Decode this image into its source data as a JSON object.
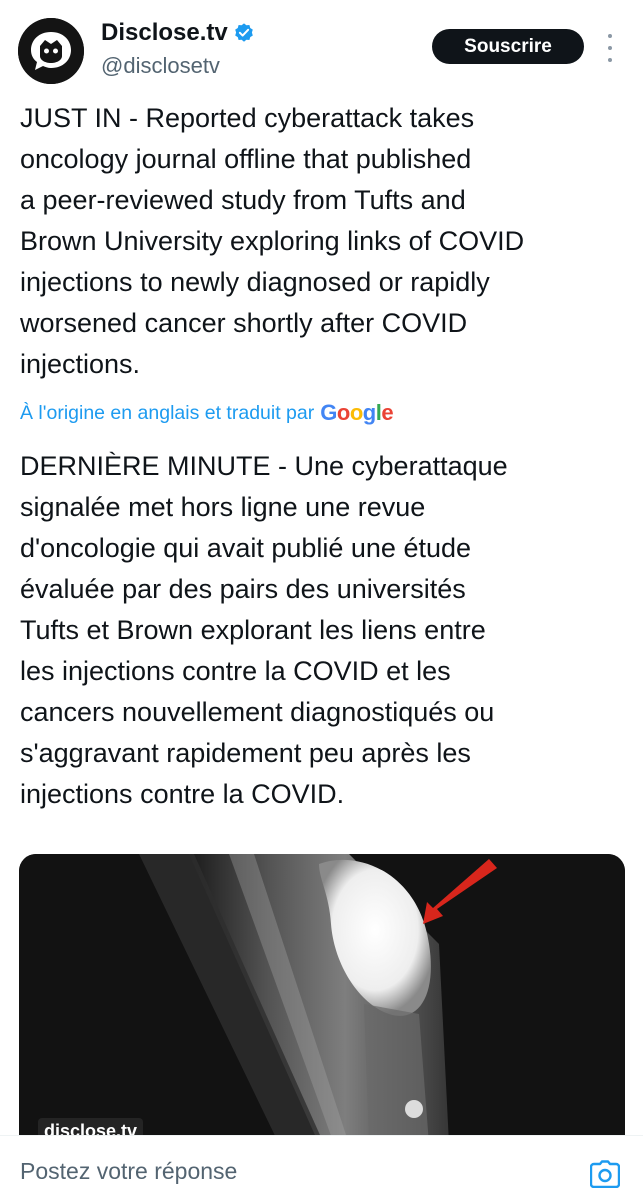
{
  "tweet": {
    "author_name": "Disclose.tv",
    "handle": "@disclosetv",
    "subscribe_label": "Souscrire",
    "original_lines": [
      "JUST IN - Reported cyberattack takes",
      "oncology journal offline that published",
      "a peer-reviewed study from Tufts and",
      "Brown University exploring links of COVID",
      "injections to newly diagnosed or rapidly",
      "worsened cancer shortly after COVID",
      "injections."
    ],
    "translation_label": "À l'origine en anglais et traduit par",
    "translation_provider": "Google",
    "translated_lines": [
      "DERNIÈRE MINUTE - Une cyberattaque",
      "signalée met hors ligne une revue",
      "d'oncologie qui avait publié une étude",
      "évaluée par des pairs des universités",
      "Tufts et Brown explorant les liens entre",
      "les injections contre la COVID et les",
      "cancers nouvellement diagnostiqués ou",
      "s'aggravant rapidement peu après les",
      "injections contre la COVID."
    ],
    "media_watermark": "disclose.tv"
  },
  "reply": {
    "placeholder": "Postez votre réponse"
  },
  "icons": {
    "verified": "verified-badge-icon",
    "more": "more-options-icon",
    "camera": "camera-icon",
    "avatar": "disclose-logo-avatar"
  },
  "colors": {
    "accent": "#1d9bf0",
    "text": "#0f1419",
    "secondary_text": "#536471",
    "button_bg": "#0f1419",
    "google_blue": "#4285f4",
    "google_red": "#ea4335",
    "google_yellow": "#fbbc05",
    "google_green": "#34a853"
  }
}
